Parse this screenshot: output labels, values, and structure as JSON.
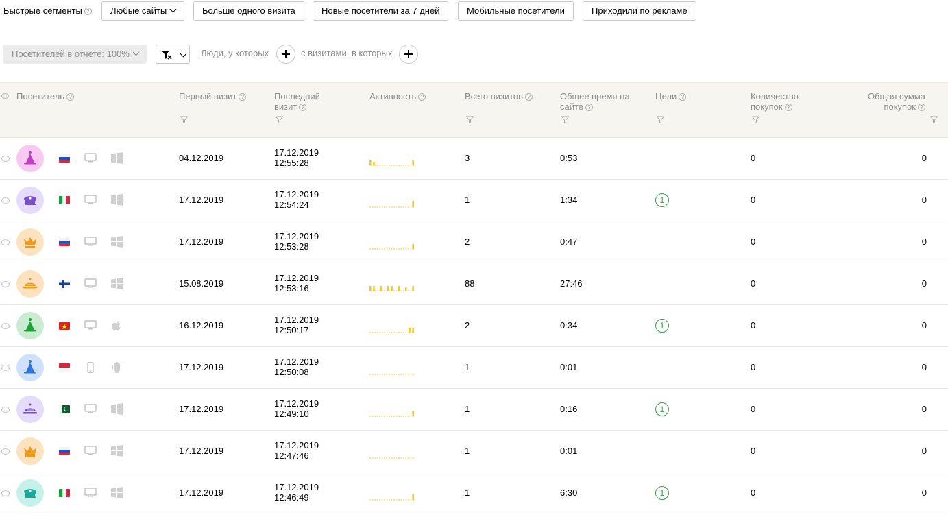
{
  "quick_segments": {
    "label": "Быстрые сегменты",
    "buttons": [
      {
        "label": "Любые сайты",
        "dropdown": true
      },
      {
        "label": "Больше одного визита"
      },
      {
        "label": "Новые посетители за 7 дней"
      },
      {
        "label": "Мобильные посетители"
      },
      {
        "label": "Приходили по рекламе"
      }
    ]
  },
  "filters": {
    "percent_label": "Посетителей в отчете: 100%",
    "people_label": "Люди, у которых",
    "visits_label": "с визитами, в которых"
  },
  "table": {
    "columns": {
      "visitor": "Посетитель",
      "first_visit": "Первый визит",
      "last_visit_l1": "Последний",
      "last_visit_l2": "визит",
      "activity": "Активность",
      "total_visits": "Всего визитов",
      "total_time_l1": "Общее время на",
      "total_time_l2": "сайте",
      "goals": "Цели",
      "purchases_l1": "Количество",
      "purchases_l2": "покупок",
      "sum_l1": "Общая сумма",
      "sum_l2": "покупок"
    },
    "rows": [
      {
        "avatar": "party-hat-icon",
        "avatar_bg": "#f8c9f3",
        "avatar_fg": "#c13fc5",
        "country": "ru",
        "device": "desktop-icon",
        "os": "windows-icon",
        "first_visit": "04.12.2019",
        "last_date": "17.12.2019",
        "last_time": "12:55:28",
        "activity": [
          1,
          0.5,
          0,
          0,
          0,
          0,
          0,
          0,
          0,
          0,
          0,
          0,
          1
        ],
        "visits": "3",
        "time": "0:53",
        "goals": "",
        "purchases": "0",
        "sum": "0"
      },
      {
        "avatar": "captain-hat-icon",
        "avatar_bg": "#e4dcfa",
        "avatar_fg": "#7a4fc7",
        "country": "it",
        "device": "desktop-icon",
        "os": "windows-icon",
        "first_visit": "17.12.2019",
        "last_date": "17.12.2019",
        "last_time": "12:54:24",
        "activity": [
          0,
          0,
          0,
          0,
          0,
          0,
          0,
          0,
          0,
          0,
          0,
          0,
          1.5
        ],
        "visits": "1",
        "time": "1:34",
        "goals": "1",
        "purchases": "0",
        "sum": "0"
      },
      {
        "avatar": "crown-icon",
        "avatar_bg": "#fde2c0",
        "avatar_fg": "#f29a18",
        "country": "ru",
        "device": "desktop-icon",
        "os": "windows-icon",
        "first_visit": "17.12.2019",
        "last_date": "17.12.2019",
        "last_time": "12:53:28",
        "activity": [
          0,
          0,
          0,
          0,
          0,
          0,
          0,
          0,
          0,
          0,
          0,
          0,
          1
        ],
        "visits": "2",
        "time": "0:47",
        "goals": "",
        "purchases": "0",
        "sum": "0"
      },
      {
        "avatar": "cloche-icon",
        "avatar_bg": "#fde2c0",
        "avatar_fg": "#f29a18",
        "country": "fi",
        "device": "desktop-icon",
        "os": "windows-icon",
        "first_visit": "15.08.2019",
        "last_date": "17.12.2019",
        "last_time": "12:53:16",
        "activity": [
          1,
          1,
          0,
          1,
          0,
          1,
          1,
          0,
          1,
          0,
          0.5,
          0,
          1
        ],
        "visits": "88",
        "time": "27:46",
        "goals": "",
        "purchases": "0",
        "sum": "0"
      },
      {
        "avatar": "party-hat-icon",
        "avatar_bg": "#c9ecd0",
        "avatar_fg": "#21a33c",
        "country": "vn",
        "device": "desktop-icon",
        "os": "apple-icon",
        "first_visit": "16.12.2019",
        "last_date": "17.12.2019",
        "last_time": "12:50:17",
        "activity": [
          0,
          0,
          0,
          0,
          0,
          0,
          0,
          0,
          0,
          0,
          0,
          1,
          1
        ],
        "visits": "2",
        "time": "0:34",
        "goals": "1",
        "purchases": "0",
        "sum": "0"
      },
      {
        "avatar": "party-hat-icon",
        "avatar_bg": "#cfe1fb",
        "avatar_fg": "#2f76e0",
        "country": "id",
        "device": "mobile-icon",
        "os": "android-icon",
        "first_visit": "17.12.2019",
        "last_date": "17.12.2019",
        "last_time": "12:50:08",
        "activity": [
          0,
          0,
          0,
          0,
          0,
          0,
          0,
          0,
          0,
          0,
          0,
          0,
          0
        ],
        "visits": "1",
        "time": "0:01",
        "goals": "",
        "purchases": "0",
        "sum": "0"
      },
      {
        "avatar": "cloche-icon",
        "avatar_bg": "#e4dcfa",
        "avatar_fg": "#7a4fc7",
        "country": "pk",
        "device": "desktop-icon",
        "os": "windows-icon",
        "first_visit": "17.12.2019",
        "last_date": "17.12.2019",
        "last_time": "12:49:10",
        "activity": [
          0,
          0,
          0,
          0,
          0,
          0,
          0,
          0,
          0,
          0,
          0,
          0,
          1
        ],
        "visits": "1",
        "time": "0:16",
        "goals": "1",
        "purchases": "0",
        "sum": "0"
      },
      {
        "avatar": "crown-icon",
        "avatar_bg": "#fde2c0",
        "avatar_fg": "#f29a18",
        "country": "ru",
        "device": "desktop-icon",
        "os": "windows-icon",
        "first_visit": "17.12.2019",
        "last_date": "17.12.2019",
        "last_time": "12:47:46",
        "activity": [
          0,
          0,
          0,
          0,
          0,
          0,
          0,
          0,
          0,
          0,
          0,
          0,
          0
        ],
        "visits": "1",
        "time": "0:01",
        "goals": "",
        "purchases": "0",
        "sum": "0"
      },
      {
        "avatar": "captain-hat-icon",
        "avatar_bg": "#c6f0ea",
        "avatar_fg": "#17a89a",
        "country": "it",
        "device": "desktop-icon",
        "os": "windows-icon",
        "first_visit": "17.12.2019",
        "last_date": "17.12.2019",
        "last_time": "12:46:49",
        "activity": [
          0,
          0,
          0,
          0,
          0,
          0,
          0,
          0,
          0,
          0,
          0,
          0,
          1.5
        ],
        "visits": "1",
        "time": "6:30",
        "goals": "1",
        "purchases": "0",
        "sum": "0"
      }
    ]
  },
  "colors": {
    "accent_activity": "#f4c81d",
    "goal_green": "#3aa04a",
    "header_bg": "#f6f5f0",
    "muted_text": "#8c8c8c"
  }
}
